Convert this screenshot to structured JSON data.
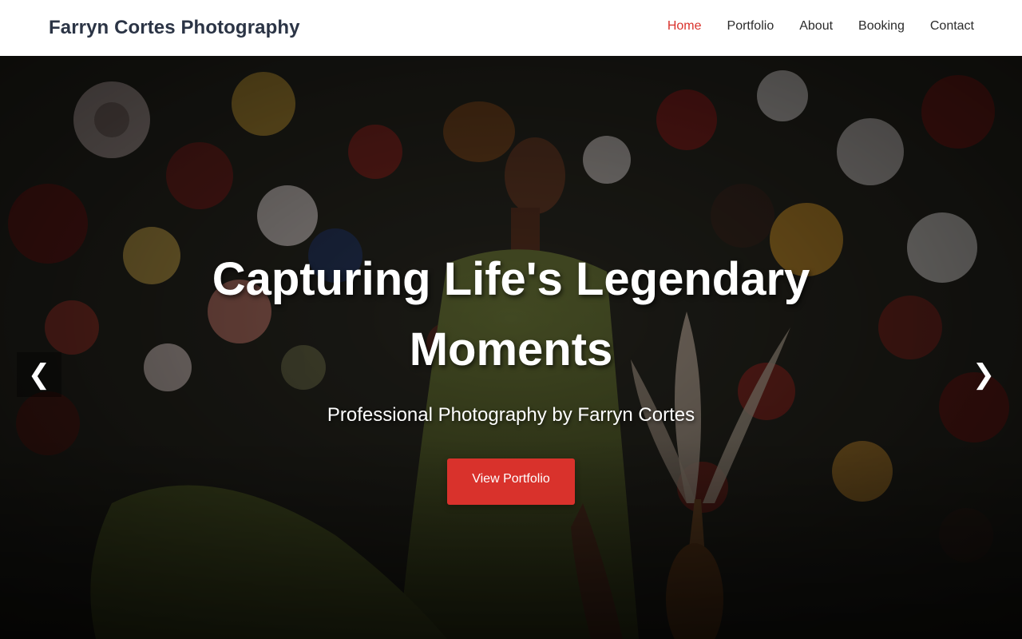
{
  "header": {
    "brand": "Farryn Cortes Photography",
    "nav": [
      {
        "label": "Home",
        "active": true
      },
      {
        "label": "Portfolio",
        "active": false
      },
      {
        "label": "About",
        "active": false
      },
      {
        "label": "Booking",
        "active": false
      },
      {
        "label": "Contact",
        "active": false
      }
    ]
  },
  "hero": {
    "title": "Capturing Life's Legendary Moments",
    "subtitle": "Professional Photography by Farryn Cortes",
    "cta_label": "View Portfolio",
    "prev_icon": "❮",
    "next_icon": "❯",
    "background_image": "maternity-portrait-floral-backdrop"
  },
  "colors": {
    "accent": "#d9322c",
    "brand_text": "#2b3445",
    "nav_text": "#2b2b2b",
    "header_bg": "#ffffff"
  }
}
